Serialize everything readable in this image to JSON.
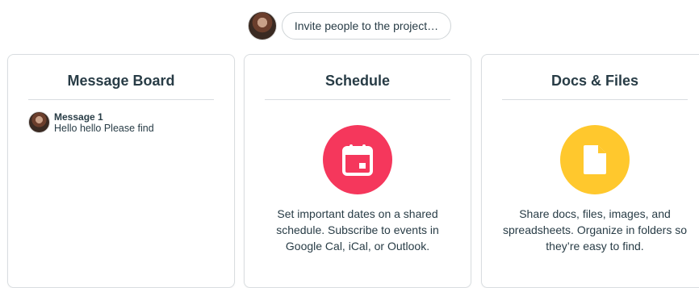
{
  "header": {
    "invite_label": "Invite people to the project…"
  },
  "cards": {
    "message_board": {
      "title": "Message Board",
      "messages": [
        {
          "title": "Message 1",
          "preview": "Hello hello Please find"
        }
      ]
    },
    "schedule": {
      "title": "Schedule",
      "description": "Set important dates on a shared schedule. Subscribe to events in Google Cal, iCal, or Outlook.",
      "accent": "#f5375c",
      "icon": "calendar-icon"
    },
    "docs": {
      "title": "Docs & Files",
      "description": "Share docs, files, images, and spreadsheets. Organize in folders so they’re easy to find.",
      "accent": "#ffc82d",
      "icon": "document-icon"
    }
  }
}
